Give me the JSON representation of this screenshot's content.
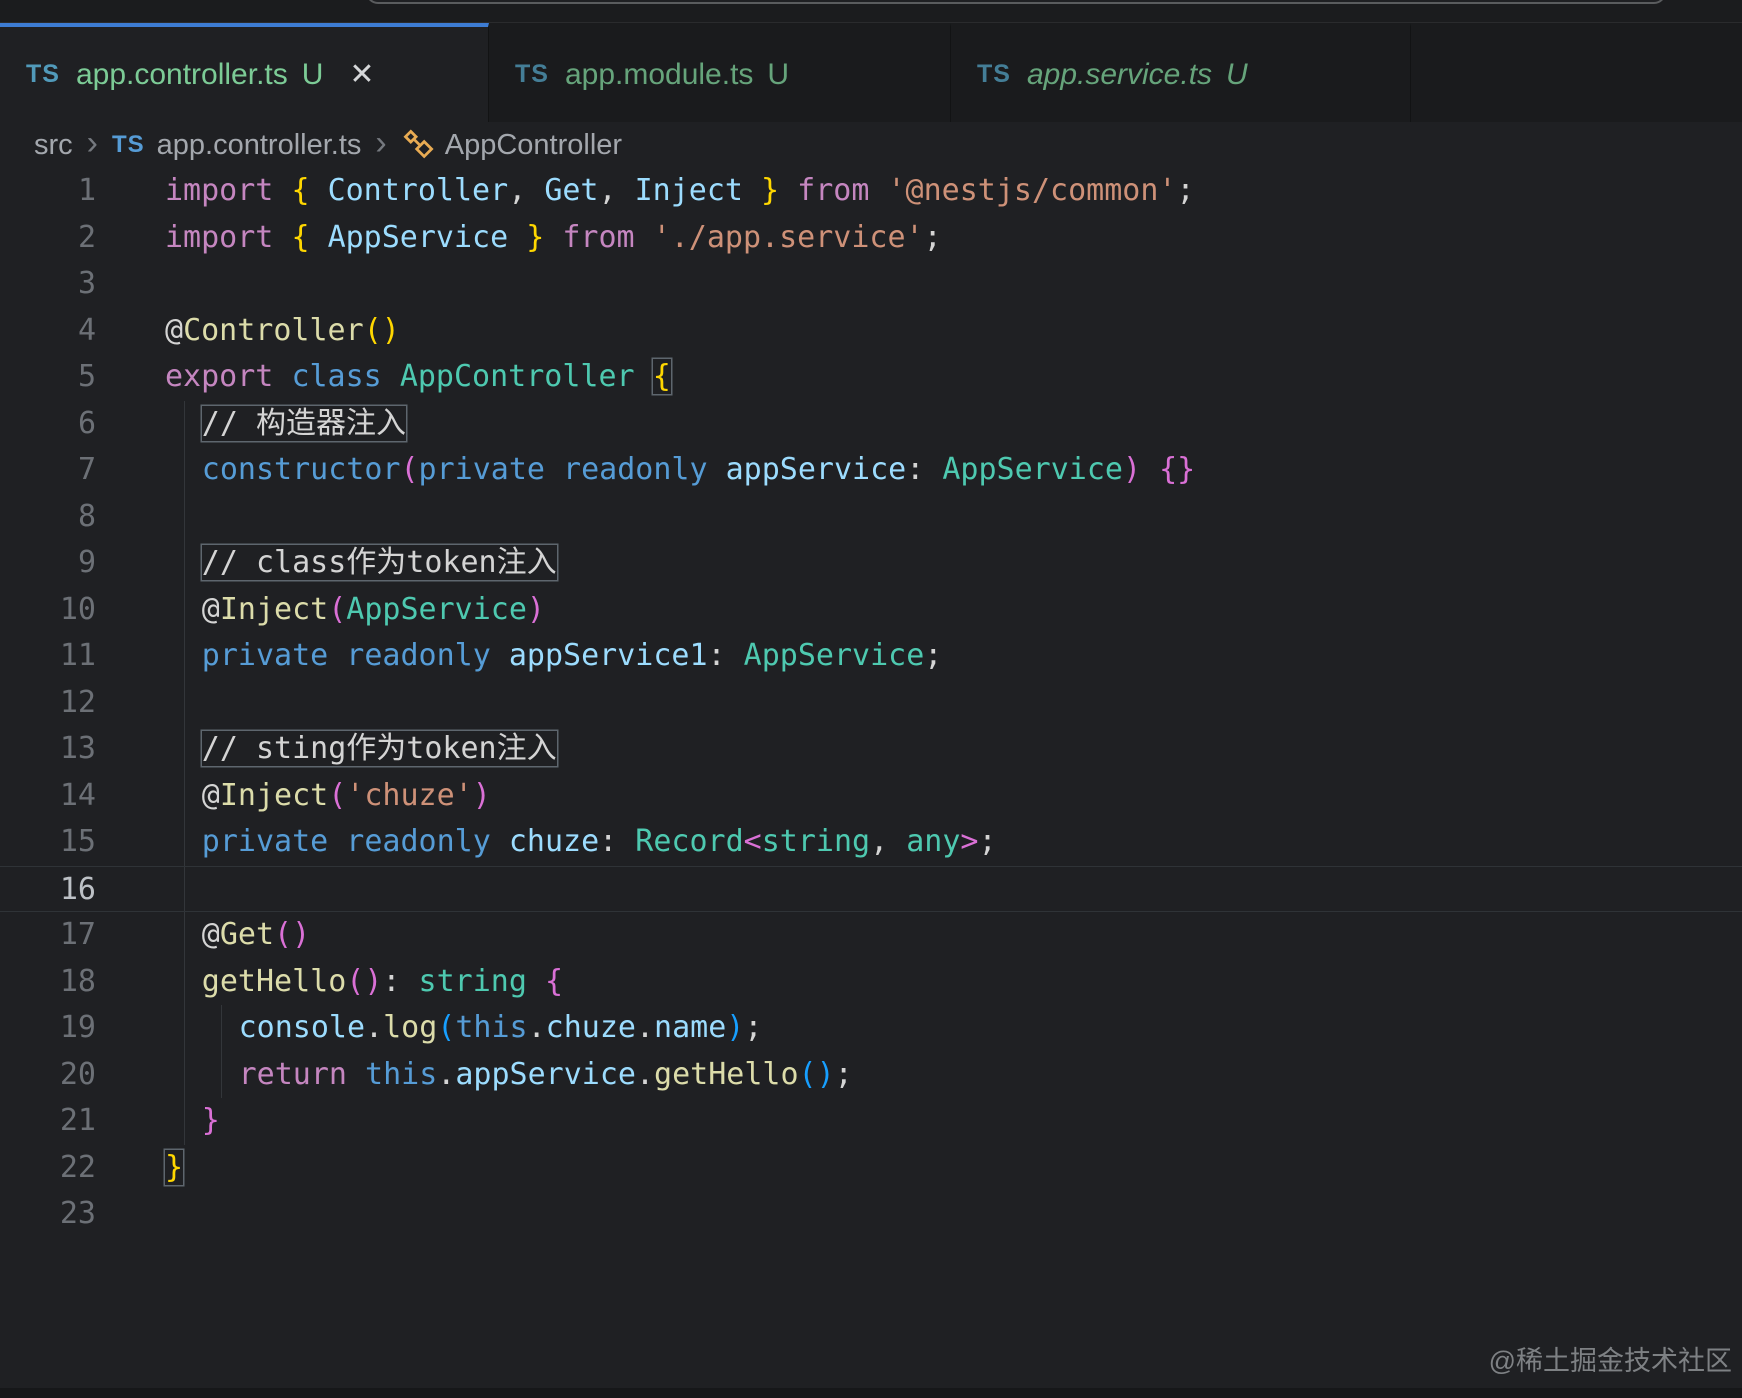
{
  "tabs": [
    {
      "icon": "TS",
      "label": "app.controller.ts",
      "git": "U",
      "active": true,
      "preview": false,
      "closable": true
    },
    {
      "icon": "TS",
      "label": "app.module.ts",
      "git": "U",
      "active": false,
      "preview": false,
      "closable": false
    },
    {
      "icon": "TS",
      "label": "app.service.ts",
      "git": "U",
      "active": false,
      "preview": true,
      "closable": false
    }
  ],
  "icons": {
    "close": "✕",
    "breadcrumb_separator": "›",
    "file_type": "TS",
    "symbol": "class-icon"
  },
  "breadcrumb": [
    {
      "label": "src",
      "icon": null
    },
    {
      "label": "app.controller.ts",
      "icon": "TS"
    },
    {
      "label": "AppController",
      "icon": "class"
    }
  ],
  "editor": {
    "current_line": 16,
    "lines": [
      {
        "n": 1,
        "indent": 0,
        "guides": 0,
        "tokens": [
          [
            "import ",
            "kw"
          ],
          [
            "{ ",
            "b1"
          ],
          [
            "Controller",
            "var"
          ],
          [
            ", ",
            "pun"
          ],
          [
            "Get",
            "var"
          ],
          [
            ", ",
            "pun"
          ],
          [
            "Inject",
            "var"
          ],
          [
            " }",
            "b1"
          ],
          [
            " from ",
            "kw"
          ],
          [
            "'@nestjs/common'",
            "str"
          ],
          [
            ";",
            "pun"
          ]
        ]
      },
      {
        "n": 2,
        "indent": 0,
        "guides": 0,
        "tokens": [
          [
            "import ",
            "kw"
          ],
          [
            "{ ",
            "b1"
          ],
          [
            "AppService",
            "var"
          ],
          [
            " }",
            "b1"
          ],
          [
            " from ",
            "kw"
          ],
          [
            "'./app.service'",
            "str"
          ],
          [
            ";",
            "pun"
          ]
        ]
      },
      {
        "n": 3,
        "indent": 0,
        "guides": 0,
        "tokens": []
      },
      {
        "n": 4,
        "indent": 0,
        "guides": 0,
        "tokens": [
          [
            "@",
            "at"
          ],
          [
            "Controller",
            "fn"
          ],
          [
            "()",
            "b1"
          ]
        ]
      },
      {
        "n": 5,
        "indent": 0,
        "guides": 0,
        "tokens": [
          [
            "export ",
            "kw"
          ],
          [
            "class ",
            "kw2"
          ],
          [
            "AppController ",
            "type"
          ],
          [
            "{",
            "b1m"
          ]
        ]
      },
      {
        "n": 6,
        "indent": 1,
        "guides": 1,
        "tokens": [
          [
            "// 构造器注入",
            "com"
          ]
        ]
      },
      {
        "n": 7,
        "indent": 1,
        "guides": 1,
        "tokens": [
          [
            "constructor",
            "kw2"
          ],
          [
            "(",
            "b2"
          ],
          [
            "private ",
            "kw2"
          ],
          [
            "readonly ",
            "kw2"
          ],
          [
            "appService",
            "var"
          ],
          [
            ": ",
            "pun"
          ],
          [
            "AppService",
            "type"
          ],
          [
            ")",
            "b2"
          ],
          [
            " ",
            "pun"
          ],
          [
            "{}",
            "b2"
          ]
        ]
      },
      {
        "n": 8,
        "indent": 1,
        "guides": 1,
        "tokens": []
      },
      {
        "n": 9,
        "indent": 1,
        "guides": 1,
        "tokens": [
          [
            "// class作为token注入",
            "com"
          ]
        ]
      },
      {
        "n": 10,
        "indent": 1,
        "guides": 1,
        "tokens": [
          [
            "@",
            "at"
          ],
          [
            "Inject",
            "fn"
          ],
          [
            "(",
            "b2"
          ],
          [
            "AppService",
            "type"
          ],
          [
            ")",
            "b2"
          ]
        ]
      },
      {
        "n": 11,
        "indent": 1,
        "guides": 1,
        "tokens": [
          [
            "private ",
            "kw2"
          ],
          [
            "readonly ",
            "kw2"
          ],
          [
            "appService1",
            "var"
          ],
          [
            ": ",
            "pun"
          ],
          [
            "AppService",
            "type"
          ],
          [
            ";",
            "pun"
          ]
        ]
      },
      {
        "n": 12,
        "indent": 1,
        "guides": 1,
        "tokens": []
      },
      {
        "n": 13,
        "indent": 1,
        "guides": 1,
        "tokens": [
          [
            "// sting作为token注入",
            "com"
          ]
        ]
      },
      {
        "n": 14,
        "indent": 1,
        "guides": 1,
        "tokens": [
          [
            "@",
            "at"
          ],
          [
            "Inject",
            "fn"
          ],
          [
            "(",
            "b2"
          ],
          [
            "'chuze'",
            "str"
          ],
          [
            ")",
            "b2"
          ]
        ]
      },
      {
        "n": 15,
        "indent": 1,
        "guides": 1,
        "tokens": [
          [
            "private ",
            "kw2"
          ],
          [
            "readonly ",
            "kw2"
          ],
          [
            "chuze",
            "var"
          ],
          [
            ": ",
            "pun"
          ],
          [
            "Record",
            "type"
          ],
          [
            "<",
            "b2"
          ],
          [
            "string",
            "type"
          ],
          [
            ", ",
            "pun"
          ],
          [
            "any",
            "type"
          ],
          [
            ">",
            "b2"
          ],
          [
            ";",
            "pun"
          ]
        ]
      },
      {
        "n": 16,
        "indent": 1,
        "guides": 1,
        "tokens": []
      },
      {
        "n": 17,
        "indent": 1,
        "guides": 1,
        "tokens": [
          [
            "@",
            "at"
          ],
          [
            "Get",
            "fn"
          ],
          [
            "()",
            "b2"
          ]
        ]
      },
      {
        "n": 18,
        "indent": 1,
        "guides": 1,
        "tokens": [
          [
            "getHello",
            "fn"
          ],
          [
            "()",
            "b2"
          ],
          [
            ": ",
            "pun"
          ],
          [
            "string ",
            "type"
          ],
          [
            "{",
            "b2"
          ]
        ]
      },
      {
        "n": 19,
        "indent": 2,
        "guides": 2,
        "tokens": [
          [
            "console",
            "var"
          ],
          [
            ".",
            "pun"
          ],
          [
            "log",
            "fn"
          ],
          [
            "(",
            "b3"
          ],
          [
            "this",
            "kw2"
          ],
          [
            ".",
            "pun"
          ],
          [
            "chuze",
            "var"
          ],
          [
            ".",
            "pun"
          ],
          [
            "name",
            "var"
          ],
          [
            ")",
            "b3"
          ],
          [
            ";",
            "pun"
          ]
        ]
      },
      {
        "n": 20,
        "indent": 2,
        "guides": 2,
        "tokens": [
          [
            "return ",
            "kw"
          ],
          [
            "this",
            "kw2"
          ],
          [
            ".",
            "pun"
          ],
          [
            "appService",
            "var"
          ],
          [
            ".",
            "pun"
          ],
          [
            "getHello",
            "fn"
          ],
          [
            "()",
            "b3"
          ],
          [
            ";",
            "pun"
          ]
        ]
      },
      {
        "n": 21,
        "indent": 1,
        "guides": 1,
        "tokens": [
          [
            "}",
            "b2"
          ]
        ]
      },
      {
        "n": 22,
        "indent": 0,
        "guides": 0,
        "tokens": [
          [
            "}",
            "b1m"
          ]
        ]
      },
      {
        "n": 23,
        "indent": 0,
        "guides": 0,
        "tokens": []
      }
    ]
  },
  "watermark": "@稀土掘金技术社区",
  "colors": {
    "editor_background": "#1f2023",
    "tabbar_background": "#1a1b1d",
    "active_tab_border": "#3d7cd3",
    "git_untracked_green": "#7ccb96",
    "ts_icon_blue": "#519aba",
    "class_icon_orange": "#e8ab53",
    "keyword_pink": "#c586c0",
    "keyword_blue": "#569cd6",
    "variable_blue": "#9cdcfe",
    "type_teal": "#4ec9b0",
    "function_yellow": "#dcdcaa",
    "string_orange": "#ce9178",
    "comment_green": "#6a9955",
    "bracket_level1": "#ffd700",
    "bracket_level2": "#da70d6",
    "bracket_level3": "#179fff"
  }
}
